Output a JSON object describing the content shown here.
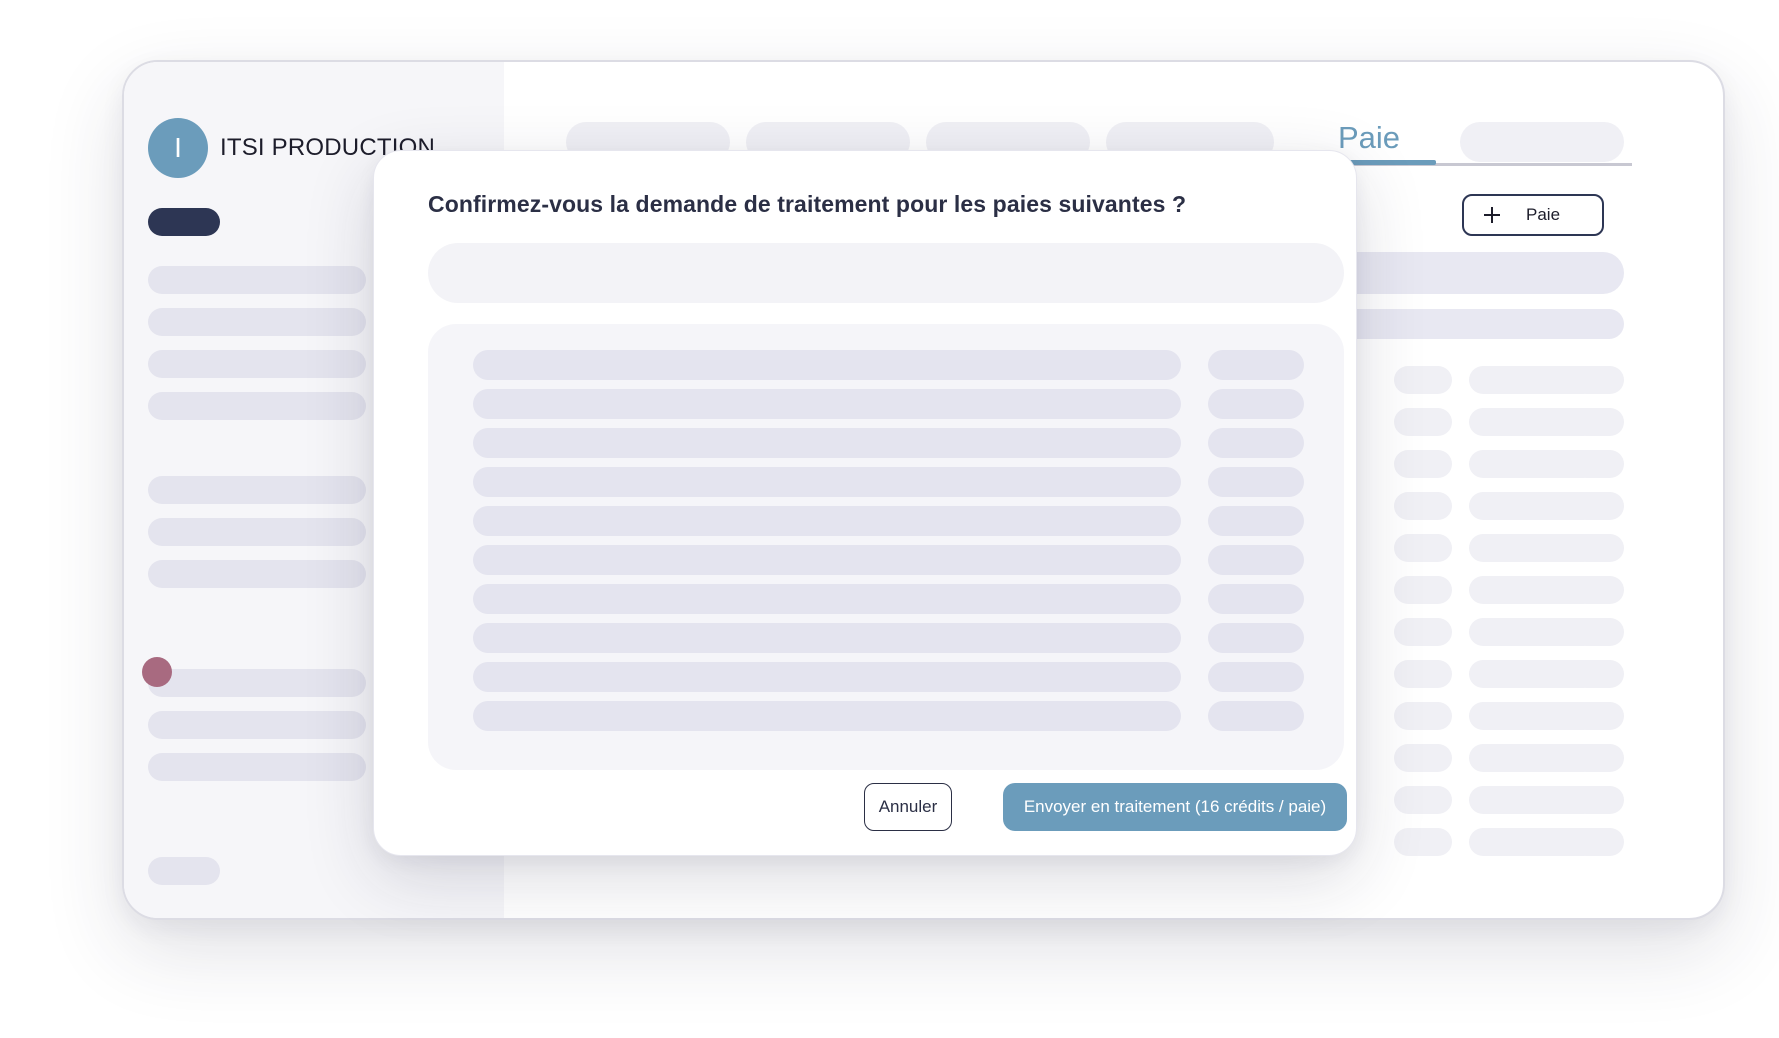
{
  "sidebar": {
    "avatar_letter": "I",
    "org_name": "ITSI PRODUCTION"
  },
  "header": {
    "active_tab": "Paie"
  },
  "toolbar": {
    "add_label": "Paie"
  },
  "modal": {
    "title": "Confirmez-vous la demande de traitement pour les paies suivantes ?",
    "cancel_label": "Annuler",
    "submit_label": "Envoyer en traitement (16 crédits / paie)"
  },
  "colors": {
    "accent": "#6b9cbb",
    "navy": "#2d3654",
    "marker": "#a86a80"
  }
}
